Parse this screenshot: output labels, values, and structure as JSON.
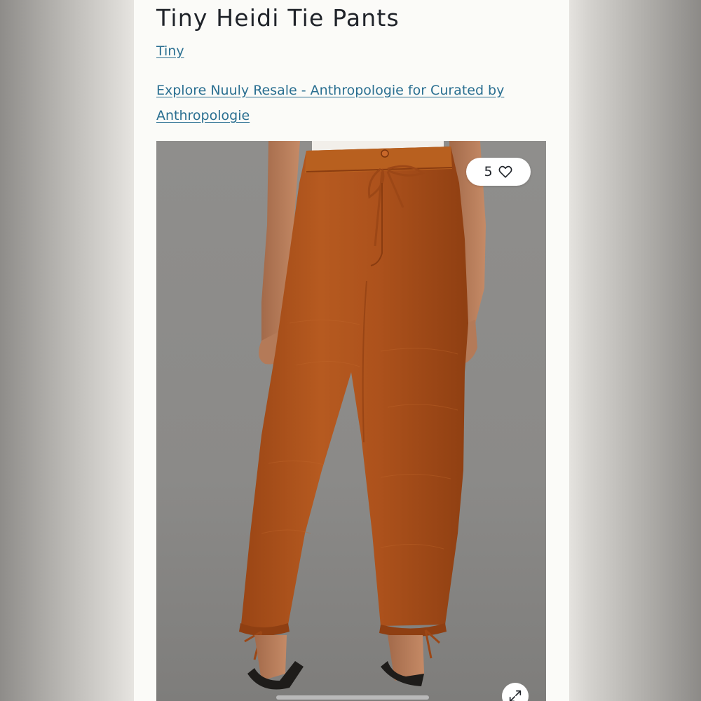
{
  "product": {
    "title": "Tiny Heidi Tie Pants",
    "brand_link": "Tiny",
    "explore_link": "Explore Nuuly Resale - Anthropologie for Curated by Anthropologie"
  },
  "image": {
    "alt": "Orange rust colored tie pants",
    "like_count": "5",
    "like_icon": "heart-outline-icon",
    "expand_icon": "expand-arrows-icon"
  },
  "colors": {
    "link": "#2a6f91",
    "pants": "#b0531c",
    "background": "#8c8b88"
  }
}
